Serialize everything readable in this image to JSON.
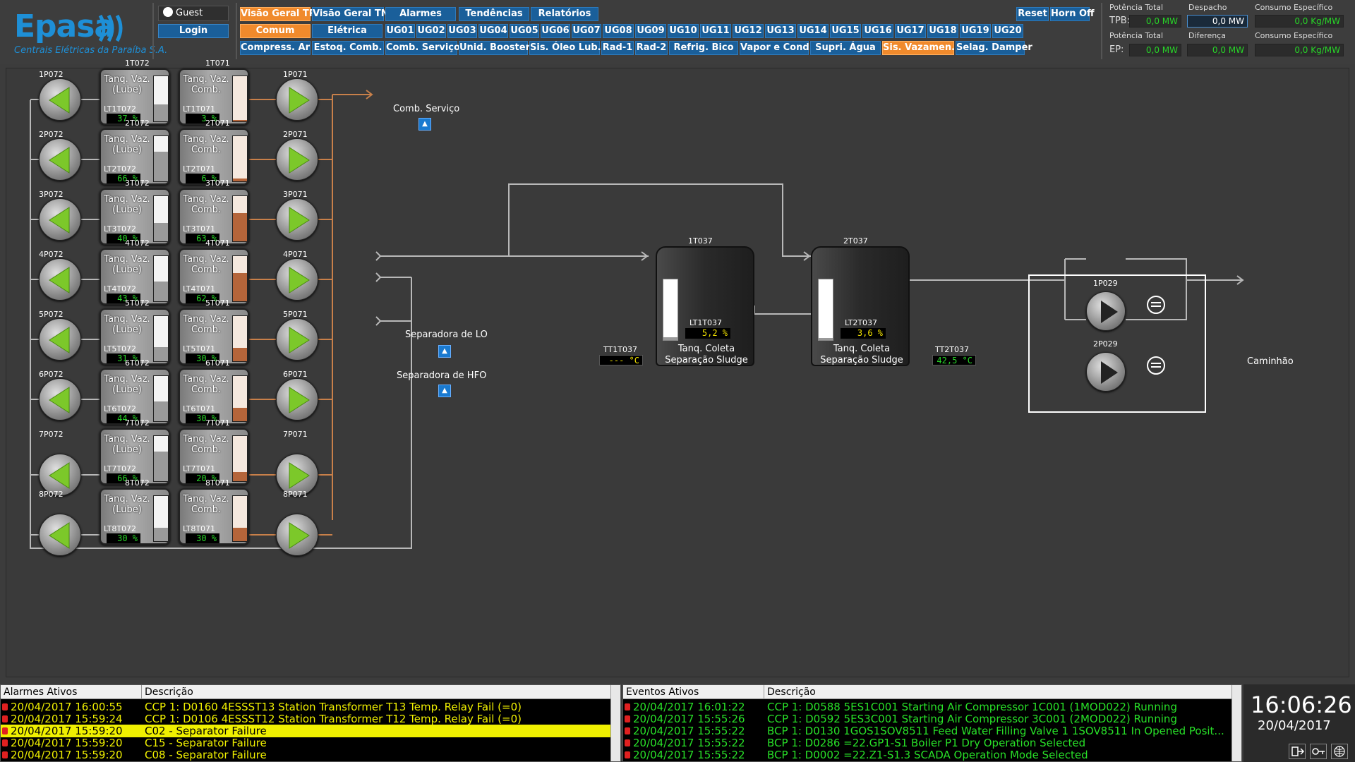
{
  "brand": {
    "name": "Epasa",
    "subtitle": "Centrais Elétricas da Paraíba S.A."
  },
  "user": {
    "name": "Guest",
    "login_label": "Login"
  },
  "nav": {
    "row1": [
      "Visão Geral TP",
      "Visão Geral TN",
      "Alarmes",
      "Tendências",
      "Relatórios"
    ],
    "row2a": [
      "Comum",
      "Elétrica"
    ],
    "ug": [
      "UG01",
      "UG02",
      "UG03",
      "UG04",
      "UG05",
      "UG06",
      "UG07",
      "UG08",
      "UG09",
      "UG10",
      "UG11",
      "UG12",
      "UG13",
      "UG14",
      "UG15",
      "UG16",
      "UG17",
      "UG18",
      "UG19",
      "UG20"
    ],
    "row3": [
      "Compress. Ar",
      "Estoq. Comb.",
      "Comb. Serviço",
      "Unid. Booster",
      "Sis. Óleo Lub.",
      "Rad-1",
      "Rad-2",
      "Refrig. Bico",
      "Vapor e Cond.",
      "Supri. Água",
      "Sis. Vazamen.",
      "Selag. Damper"
    ],
    "reset": "Reset",
    "horn": "Horn Off"
  },
  "readouts": {
    "pot_total_label": "Potência Total",
    "despacho_label": "Despacho",
    "consumo_label": "Consumo Específico",
    "diferenca_label": "Diferença",
    "tpb": "TPB:",
    "ep": "EP:",
    "tpb_pot": "0,0 MW",
    "despacho": "0,0 MW",
    "tpb_consumo": "0,0 Kg/MW",
    "ep_pot": "0,0 MW",
    "diferenca": "0,0 MW",
    "ep_consumo": "0,0 Kg/MW"
  },
  "tanks": [
    {
      "lube_tag": "1T072",
      "comb_tag": "1T071",
      "lube_lt": "LT1T072",
      "comb_lt": "LT1T071",
      "lube_pct": "37",
      "comb_pct": "3",
      "lube_level": 0.37,
      "comb_level": 0.03,
      "p_left": "1P072",
      "p_right": "1P071"
    },
    {
      "lube_tag": "2T072",
      "comb_tag": "2T071",
      "lube_lt": "LT2T072",
      "comb_lt": "LT2T071",
      "lube_pct": "66",
      "comb_pct": "6",
      "lube_level": 0.66,
      "comb_level": 0.06,
      "p_left": "2P072",
      "p_right": "2P071"
    },
    {
      "lube_tag": "3T072",
      "comb_tag": "3T071",
      "lube_lt": "LT3T072",
      "comb_lt": "LT3T071",
      "lube_pct": "40",
      "comb_pct": "63",
      "lube_level": 0.4,
      "comb_level": 0.63,
      "p_left": "3P072",
      "p_right": "3P071"
    },
    {
      "lube_tag": "4T072",
      "comb_tag": "4T071",
      "lube_lt": "LT4T072",
      "comb_lt": "LT4T071",
      "lube_pct": "43",
      "comb_pct": "62",
      "lube_level": 0.43,
      "comb_level": 0.62,
      "p_left": "4P072",
      "p_right": "4P071"
    },
    {
      "lube_tag": "5T072",
      "comb_tag": "5T071",
      "lube_lt": "LT5T072",
      "comb_lt": "LT5T071",
      "lube_pct": "31",
      "comb_pct": "30",
      "lube_level": 0.31,
      "comb_level": 0.3,
      "p_left": "5P072",
      "p_right": "5P071"
    },
    {
      "lube_tag": "6T072",
      "comb_tag": "6T071",
      "lube_lt": "LT6T072",
      "comb_lt": "LT6T071",
      "lube_pct": "44",
      "comb_pct": "30",
      "lube_level": 0.44,
      "comb_level": 0.3,
      "p_left": "6P072",
      "p_right": "6P071"
    },
    {
      "lube_tag": "7T072",
      "comb_tag": "7T071",
      "lube_lt": "LT7T072",
      "comb_lt": "LT7T071",
      "lube_pct": "66",
      "comb_pct": "20",
      "lube_level": 0.66,
      "comb_level": 0.2,
      "p_left": "7P072",
      "p_right": "7P071"
    },
    {
      "lube_tag": "8T072",
      "comb_tag": "8T071",
      "lube_lt": "LT8T072",
      "comb_lt": "LT8T071",
      "lube_pct": "30",
      "comb_pct": "30",
      "lube_level": 0.3,
      "comb_level": 0.3,
      "p_left": "8P072",
      "p_right": "8P071"
    }
  ],
  "tank_text": {
    "lube": "Tanq. Vaz.\n(Lube)",
    "comb": "Tanq. Vaz.\nComb.",
    "pct_unit": "%"
  },
  "process": {
    "comb_servico": "Comb. Serviço",
    "sep_lo": "Separadora de LO",
    "sep_hfo": "Separadora de HFO",
    "tt1": "TT1T037",
    "tt1_val": "--- °C",
    "tt2": "TT2T037",
    "tt2_val": "42,5 °C",
    "t1_tag": "1T037",
    "t1_lt": "LT1T037",
    "t1_val": "5,2 %",
    "t1_level": 0.052,
    "t2_tag": "2T037",
    "t2_lt": "LT2T037",
    "t2_val": "3,6 %",
    "t2_level": 0.036,
    "sludge_name": "Tanq. Coleta\nSeparação Sludge",
    "p1": "1P029",
    "p2": "2P029",
    "caminhao": "Caminhão"
  },
  "alarms": {
    "col1": "Alarmes Ativos",
    "col2": "Descrição",
    "rows": [
      {
        "time": "20/04/2017 16:00:55",
        "desc": "CCP 1: D0160 4ESSST13 Station Transformer T13 Temp. Relay Fail (=0)",
        "style": "yb"
      },
      {
        "time": "20/04/2017 15:59:24",
        "desc": "CCP 1: D0106 4ESSST12 Station Transformer T12 Temp. Relay Fail (=0)",
        "style": "yb"
      },
      {
        "time": "20/04/2017 15:59:20",
        "desc": "C02 - Separator Failure",
        "style": "hl"
      },
      {
        "time": "20/04/2017 15:59:20",
        "desc": "C15 - Separator Failure",
        "style": "yb"
      },
      {
        "time": "20/04/2017 15:59:20",
        "desc": "C08 - Separator Failure",
        "style": "yb"
      }
    ]
  },
  "events": {
    "col1": "Eventos Ativos",
    "col2": "Descrição",
    "rows": [
      {
        "time": "20/04/2017 16:01:22",
        "desc": "CCP 1: D0588 5ES1C001 Starting Air Compressor 1C001 (1MOD022) Running"
      },
      {
        "time": "20/04/2017 15:55:26",
        "desc": "CCP 1: D0592 5ES3C001 Starting Air Compressor 3C001 (2MOD022) Running"
      },
      {
        "time": "20/04/2017 15:55:22",
        "desc": "BCP 1: D0130 1GOS1SOV8511 Feed Water Filling Valve 1 1SOV8511 In Opened Posit..."
      },
      {
        "time": "20/04/2017 15:55:22",
        "desc": "BCP 1: D0286 =22.GP1-S1 Boiler P1 Dry Operation Selected"
      },
      {
        "time": "20/04/2017 15:55:22",
        "desc": "BCP 1: D0002 =22.Z1-S1.3 SCADA Operation Mode Selected"
      }
    ]
  },
  "clock": {
    "time": "16:06:26",
    "date": "20/04/2017"
  },
  "colors": {
    "accent": "#f08a2c",
    "nav": "#1a5f9a",
    "green": "#28d428",
    "yellow": "#f0e000",
    "pipe_orange": "#c8804a"
  }
}
